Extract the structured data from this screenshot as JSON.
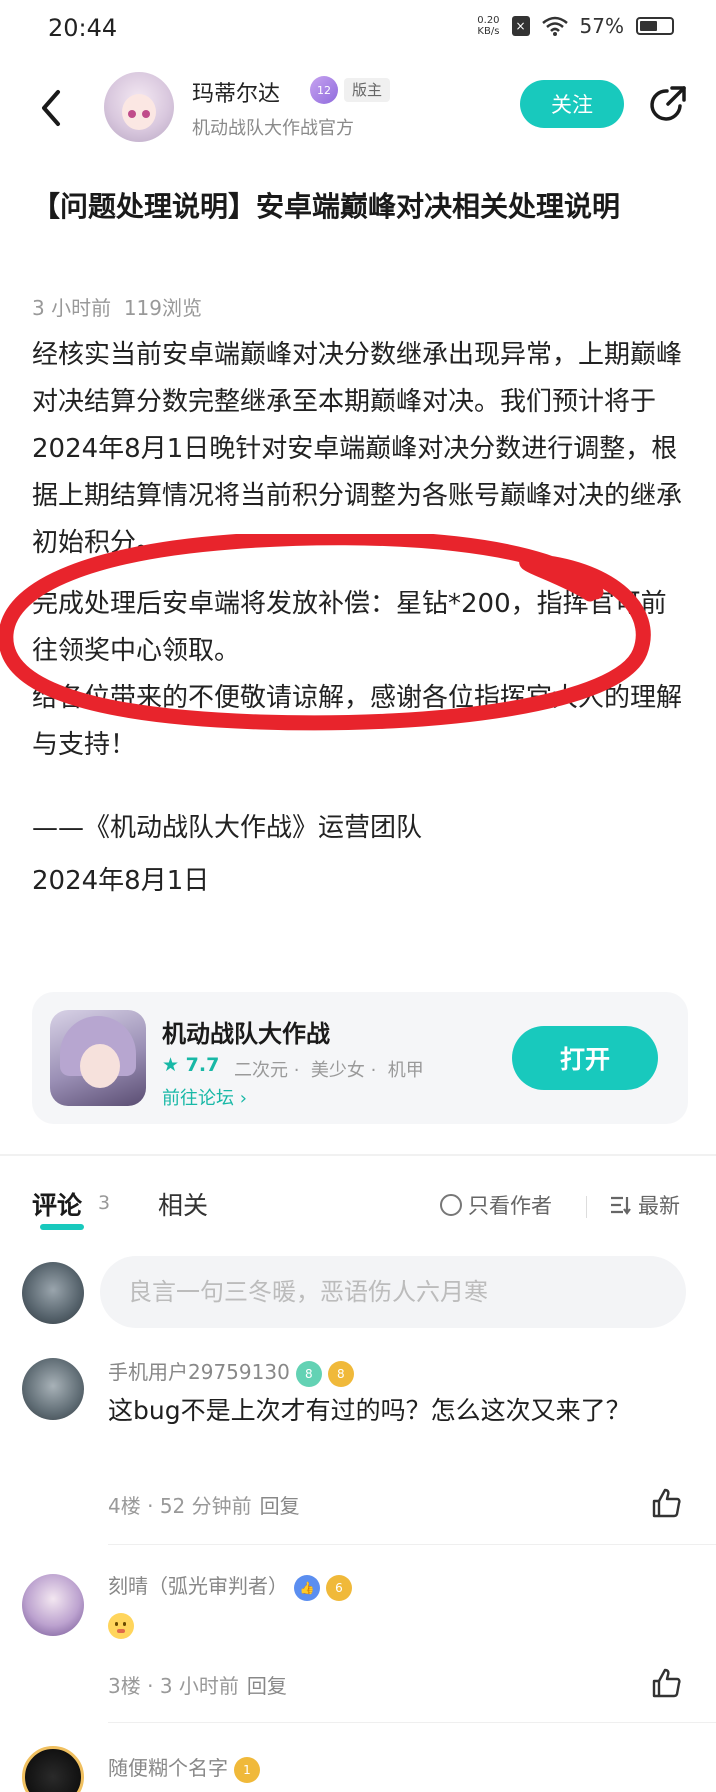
{
  "status": {
    "time": "20:44",
    "net_speed_value": "0.20",
    "net_speed_unit": "KB/s",
    "battery": "57%",
    "battery_level": 0.57
  },
  "header": {
    "author_name": "玛蒂尔达",
    "level": "12",
    "role_badge": "版主",
    "author_subtitle": "机动战队大作战官方",
    "follow_label": "关注"
  },
  "article": {
    "title": "【问题处理说明】安卓端巅峰对决相关处理说明",
    "time_ago": "3 小时前",
    "views": "119浏览",
    "paragraphs": [
      "经核实当前安卓端巅峰对决分数继承出现异常，上期巅峰对决结算分数完整继承至本期巅峰对决。我们预计将于2024年8月1日晚针对安卓端巅峰对决分数进行调整，根据上期结算情况将当前积分调整为各账号巅峰对决的继承初始积分。",
      "完成处理后安卓端将发放补偿：星钻*200，指挥官可前往领奖中心领取。",
      "给各位带来的不便敬请谅解，感谢各位指挥官大人的理解与支持！"
    ],
    "signature": "——《机动战队大作战》运营团队",
    "date": "2024年8月1日"
  },
  "game_card": {
    "name": "机动战队大作战",
    "rating": "7.7",
    "tags": [
      "二次元",
      "美少女",
      "机甲"
    ],
    "forum_link": "前往论坛",
    "open_label": "打开"
  },
  "tabs": {
    "comments_label": "评论",
    "comments_count": "3",
    "related_label": "相关",
    "author_only_label": "只看作者",
    "sort_label": "最新"
  },
  "comment_input": {
    "placeholder": "良言一句三冬暖，恶语伤人六月寒"
  },
  "comments": [
    {
      "user": "手机用户29759130",
      "badge_level": "8",
      "badge_rank": "8",
      "text": "这bug不是上次才有过的吗？怎么这次又来了？",
      "floor": "4楼",
      "time": "52 分钟前",
      "reply_label": "回复"
    },
    {
      "user": "刻晴（弧光审判者）",
      "badge_rank": "6",
      "text": "",
      "floor": "3楼",
      "time": "3 小时前",
      "reply_label": "回复"
    },
    {
      "user": "随便糊个名字",
      "badge_rank": "1"
    }
  ],
  "colors": {
    "accent": "#18c9bd",
    "annotation_red": "#e8242c"
  }
}
